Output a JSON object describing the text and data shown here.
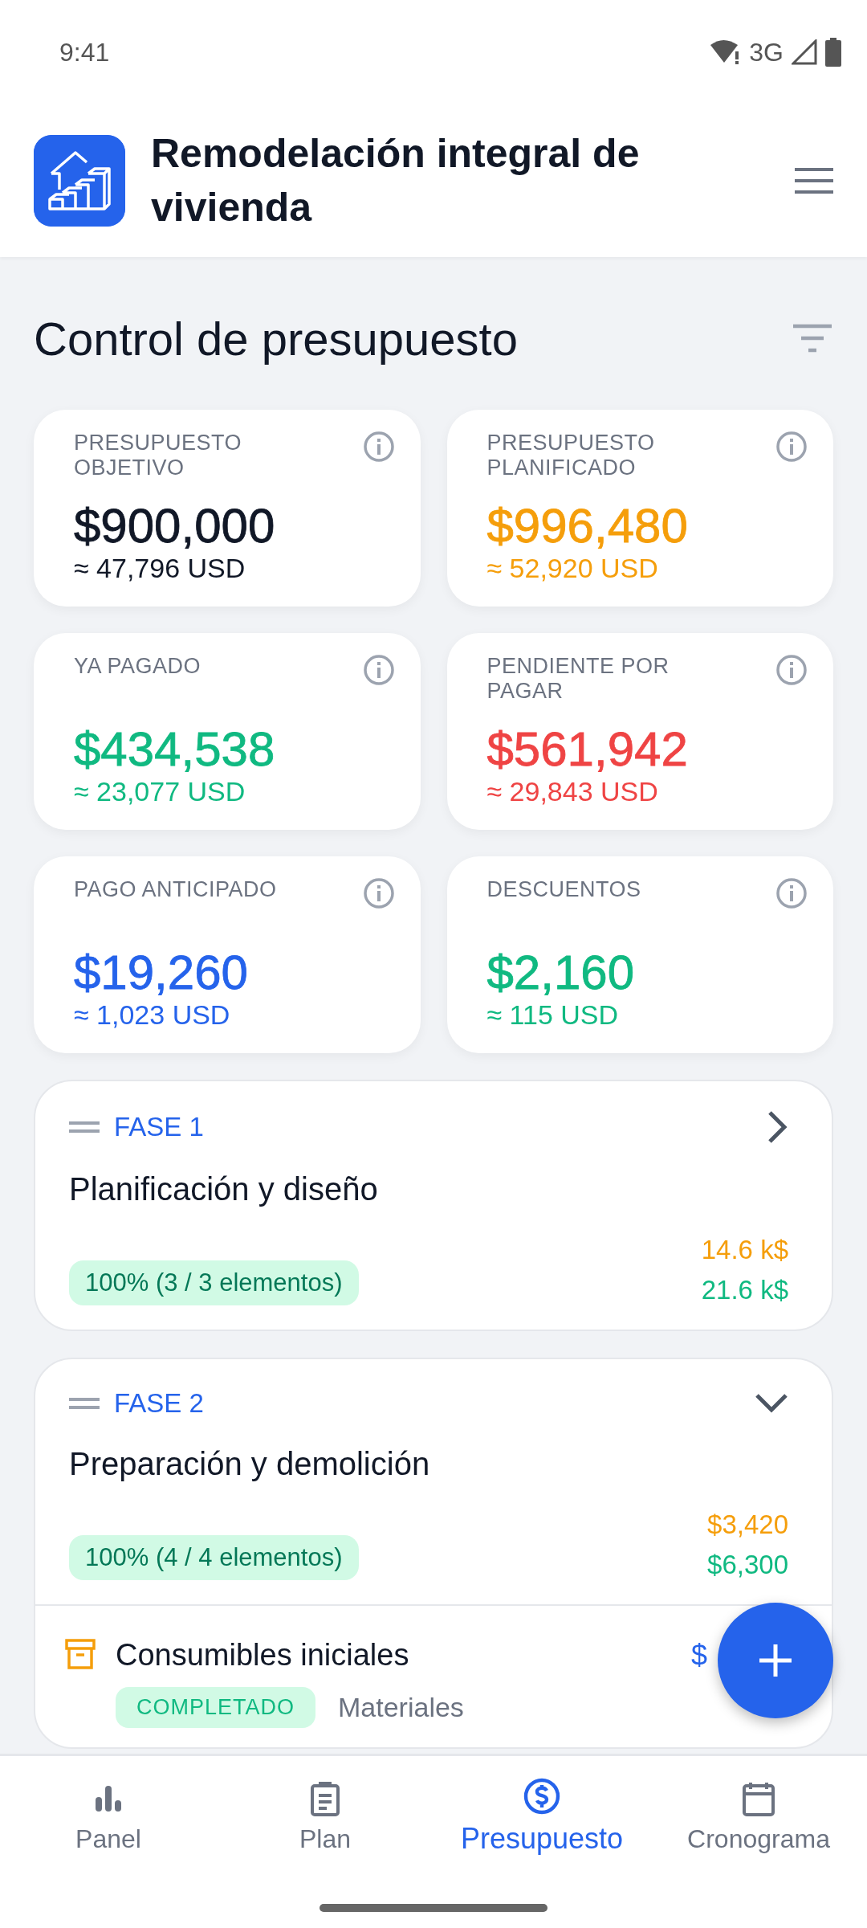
{
  "status_bar": {
    "time": "9:41",
    "network": "3G"
  },
  "header": {
    "title": "Remodelación integral de vivienda"
  },
  "section": {
    "title": "Control de presupuesto"
  },
  "metrics": [
    {
      "label": "PRESUPUESTO OBJETIVO",
      "value": "$900,000",
      "usd": "≈ 47,796 USD",
      "color": "#111827"
    },
    {
      "label": "PRESUPUESTO PLANIFICADO",
      "value": "$996,480",
      "usd": "≈ 52,920 USD",
      "color": "#f59e0b"
    },
    {
      "label": "YA PAGADO",
      "value": "$434,538",
      "usd": "≈ 23,077 USD",
      "color": "#10b981"
    },
    {
      "label": "PENDIENTE POR PAGAR",
      "value": "$561,942",
      "usd": "≈ 29,843 USD",
      "color": "#ef4444"
    },
    {
      "label": "PAGO ANTICIPADO",
      "value": "$19,260",
      "usd": "≈ 1,023 USD",
      "color": "#2563eb"
    },
    {
      "label": "DESCUENTOS",
      "value": "$2,160",
      "usd": "≈ 115 USD",
      "color": "#10b981"
    }
  ],
  "phases": [
    {
      "phase": "FASE 1",
      "title": "Planificación y diseño",
      "progress": "100% (3 / 3 elementos)",
      "planned": "14.6 k$",
      "paid": "21.6 k$",
      "expanded": false
    },
    {
      "phase": "FASE 2",
      "title": "Preparación y demolición",
      "progress": "100% (4 / 4 elementos)",
      "planned": "$3,420",
      "paid": "$6,300",
      "expanded": true,
      "items": [
        {
          "name": "Consumibles iniciales",
          "status": "COMPLETADO",
          "category": "Materiales",
          "amount": "$"
        }
      ]
    }
  ],
  "nav": [
    {
      "label": "Panel",
      "kind": "chart",
      "selected": false
    },
    {
      "label": "Plan",
      "kind": "clipboard",
      "selected": false
    },
    {
      "label": "Presupuesto",
      "kind": "dollar",
      "selected": true
    },
    {
      "label": "Cronograma",
      "kind": "calendar",
      "selected": false
    }
  ]
}
